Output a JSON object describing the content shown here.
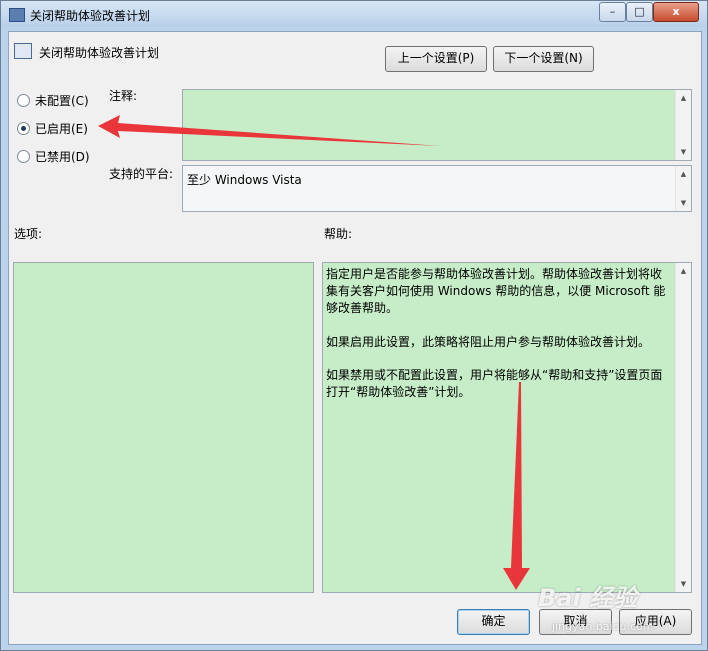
{
  "window": {
    "title": "关闭帮助体验改善计划",
    "minimize": "–",
    "maximize": "□",
    "close": "x"
  },
  "header": {
    "policy_name": "关闭帮助体验改善计划",
    "prev_button": "上一个设置(P)",
    "next_button": "下一个设置(N)"
  },
  "radios": [
    {
      "label": "未配置(C)",
      "selected": false
    },
    {
      "label": "已启用(E)",
      "selected": true
    },
    {
      "label": "已禁用(D)",
      "selected": false
    }
  ],
  "comment": {
    "label": "注释:",
    "value": ""
  },
  "platform": {
    "label": "支持的平台:",
    "value": "至少 Windows Vista"
  },
  "options": {
    "label": "选项:"
  },
  "help": {
    "label": "帮助:",
    "paragraphs": [
      "指定用户是否能参与帮助体验改善计划。帮助体验改善计划将收集有关客户如何使用 Windows 帮助的信息，以便 Microsoft 能够改善帮助。",
      "如果启用此设置，此策略将阻止用户参与帮助体验改善计划。",
      "如果禁用或不配置此设置，用户将能够从“帮助和支持”设置页面打开“帮助体验改善”计划。"
    ]
  },
  "footer": {
    "ok": "确定",
    "cancel": "取消",
    "apply": "应用(A)"
  },
  "watermark": {
    "logo": "Bai 经验",
    "url": "jingyan.baidu.com"
  },
  "colors": {
    "arrow": "#e8363a",
    "panel_green": "#c6edc8"
  }
}
